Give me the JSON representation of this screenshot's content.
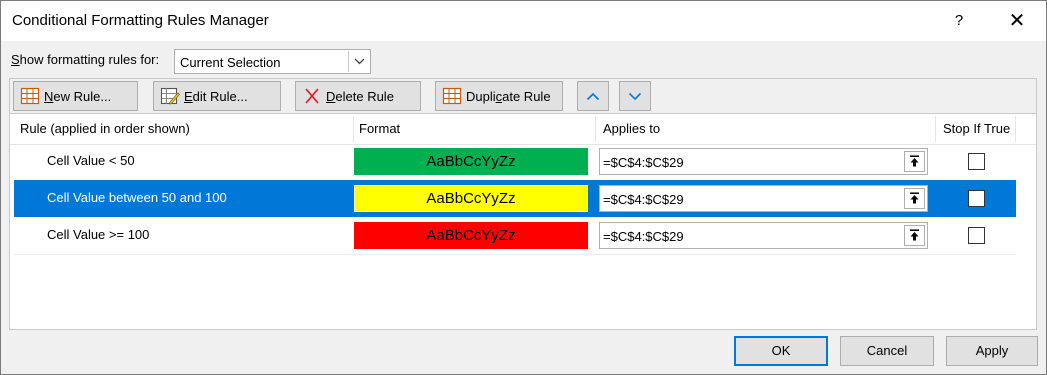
{
  "window": {
    "title": "Conditional Formatting Rules Manager",
    "help_label": "?",
    "close_label": "✕"
  },
  "show_rules": {
    "label_underlined": "S",
    "label_rest": "how formatting rules for:",
    "selected": "Current Selection"
  },
  "toolbar": {
    "new_rule_u": "N",
    "new_rule_rest": "ew Rule...",
    "edit_rule_u": "E",
    "edit_rule_rest": "dit Rule...",
    "delete_rule_u": "D",
    "delete_rule_rest": "elete Rule",
    "duplicate_rule_pre": "Dupli",
    "duplicate_rule_u": "c",
    "duplicate_rule_rest": "ate Rule"
  },
  "columns": {
    "rule": "Rule (applied in order shown)",
    "format": "Format",
    "applies_to": "Applies to",
    "stop_if_true": "Stop If True"
  },
  "rules": [
    {
      "rule": "Cell Value < 50",
      "preview": "AaBbCcYyZz",
      "fill": "#00b050",
      "applies_to": "=$C$4:$C$29",
      "stop_if_true": false,
      "selected": false
    },
    {
      "rule": "Cell Value between 50 and 100",
      "preview": "AaBbCcYyZz",
      "fill": "#ffff00",
      "applies_to": "=$C$4:$C$29",
      "stop_if_true": false,
      "selected": true
    },
    {
      "rule": "Cell Value >= 100",
      "preview": "AaBbCcYyZz",
      "fill": "#ff0000",
      "applies_to": "=$C$4:$C$29",
      "stop_if_true": false,
      "selected": false
    }
  ],
  "footer": {
    "ok": "OK",
    "cancel": "Cancel",
    "apply": "Apply"
  },
  "colors": {
    "accent": "#0078d7",
    "dialog_bg": "#f0f0f0"
  }
}
